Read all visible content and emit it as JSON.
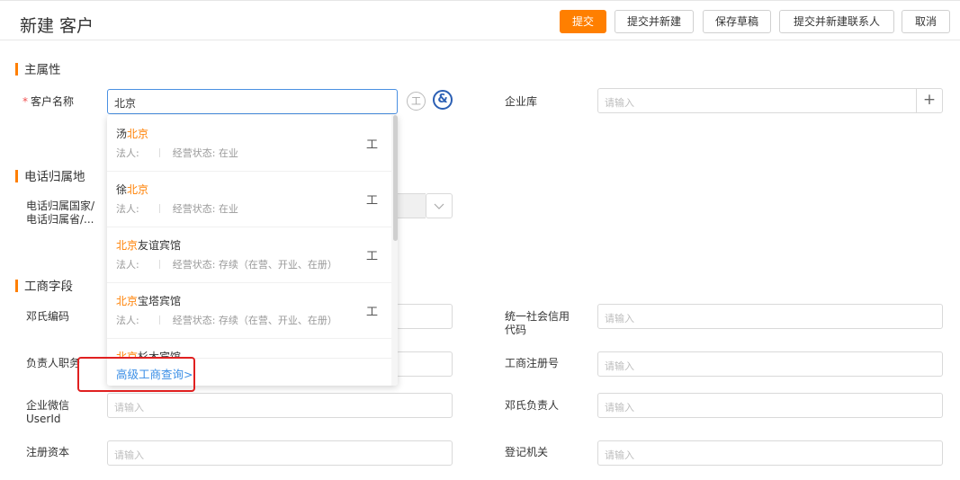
{
  "header": {
    "title": "新建 客户",
    "buttons": {
      "submit": "提交",
      "submit_new": "提交并新建",
      "save_draft": "保存草稿",
      "submit_contact": "提交并新建联系人",
      "cancel": "取消"
    }
  },
  "colors": {
    "accent": "#ff7f00",
    "link": "#3a8ee6",
    "highlight_box": "#e02020"
  },
  "sections": {
    "main": "主属性",
    "phone": "电话归属地",
    "business": "工商字段"
  },
  "main": {
    "customer_name_label": "客户名称",
    "customer_name_value": "北京",
    "required_mark": "*",
    "gong_icon": "工",
    "enterprise_label": "企业库",
    "enterprise_placeholder": "请输入",
    "plus": "+"
  },
  "phone": {
    "label_line1": "电话归属国家/",
    "label_line2": "电话归属省/..."
  },
  "dropdown": {
    "items": [
      {
        "prefix": "汤",
        "hl": "北京",
        "suffix": "",
        "legal": "法人:",
        "status": "经营状态: 在业",
        "icon": "工"
      },
      {
        "prefix": "徐",
        "hl": "北京",
        "suffix": "",
        "legal": "法人:",
        "status": "经营状态: 在业",
        "icon": "工"
      },
      {
        "prefix": "",
        "hl": "北京",
        "suffix": "友谊宾馆",
        "legal": "法人:",
        "status": "经营状态: 存续（在营、开业、在册）",
        "icon": "工"
      },
      {
        "prefix": "",
        "hl": "北京",
        "suffix": "宝塔宾馆",
        "legal": "法人:",
        "status": "经营状态: 存续（在营、开业、在册）",
        "icon": "工"
      },
      {
        "prefix": "",
        "hl": "北京",
        "suffix": "杉木宾馆",
        "legal": "",
        "status": "",
        "icon": ""
      }
    ],
    "advanced": "高级工商查询>"
  },
  "fields": {
    "deng_code": "邓氏编码",
    "credit_code_1": "统一社会信用",
    "credit_code_2": "代码",
    "leader_post": "负责人职务",
    "reg_no": "工商注册号",
    "wechat_1": "企业微信",
    "wechat_2": "UserId",
    "deng_leader": "邓氏负责人",
    "capital": "注册资本",
    "authority": "登记机关",
    "placeholder": "请输入"
  }
}
